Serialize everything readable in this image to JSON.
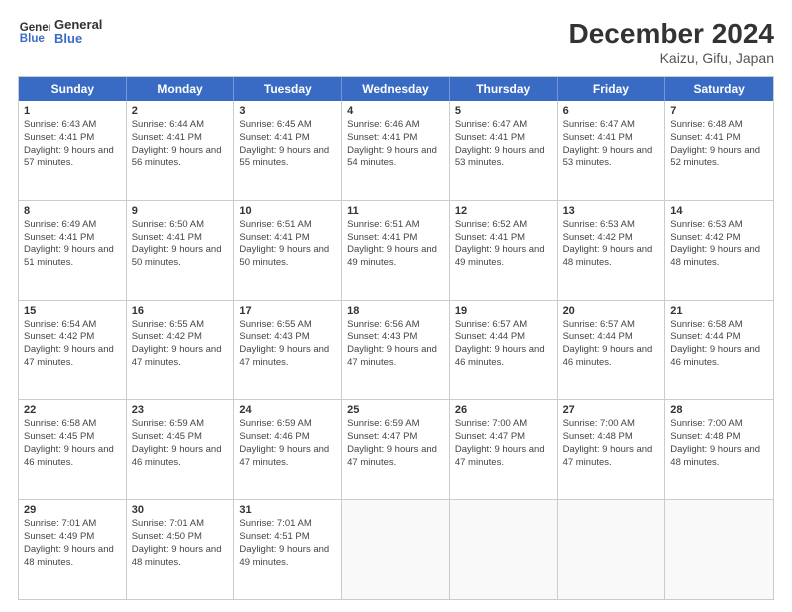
{
  "header": {
    "logo_line1": "General",
    "logo_line2": "Blue",
    "title": "December 2024",
    "subtitle": "Kaizu, Gifu, Japan"
  },
  "weekdays": [
    "Sunday",
    "Monday",
    "Tuesday",
    "Wednesday",
    "Thursday",
    "Friday",
    "Saturday"
  ],
  "weeks": [
    [
      {
        "day": "1",
        "rise": "6:43 AM",
        "set": "4:41 PM",
        "hours": "9 hours and 57 minutes."
      },
      {
        "day": "2",
        "rise": "6:44 AM",
        "set": "4:41 PM",
        "hours": "9 hours and 56 minutes."
      },
      {
        "day": "3",
        "rise": "6:45 AM",
        "set": "4:41 PM",
        "hours": "9 hours and 55 minutes."
      },
      {
        "day": "4",
        "rise": "6:46 AM",
        "set": "4:41 PM",
        "hours": "9 hours and 54 minutes."
      },
      {
        "day": "5",
        "rise": "6:47 AM",
        "set": "4:41 PM",
        "hours": "9 hours and 53 minutes."
      },
      {
        "day": "6",
        "rise": "6:47 AM",
        "set": "4:41 PM",
        "hours": "9 hours and 53 minutes."
      },
      {
        "day": "7",
        "rise": "6:48 AM",
        "set": "4:41 PM",
        "hours": "9 hours and 52 minutes."
      }
    ],
    [
      {
        "day": "8",
        "rise": "6:49 AM",
        "set": "4:41 PM",
        "hours": "9 hours and 51 minutes."
      },
      {
        "day": "9",
        "rise": "6:50 AM",
        "set": "4:41 PM",
        "hours": "9 hours and 50 minutes."
      },
      {
        "day": "10",
        "rise": "6:51 AM",
        "set": "4:41 PM",
        "hours": "9 hours and 50 minutes."
      },
      {
        "day": "11",
        "rise": "6:51 AM",
        "set": "4:41 PM",
        "hours": "9 hours and 49 minutes."
      },
      {
        "day": "12",
        "rise": "6:52 AM",
        "set": "4:41 PM",
        "hours": "9 hours and 49 minutes."
      },
      {
        "day": "13",
        "rise": "6:53 AM",
        "set": "4:42 PM",
        "hours": "9 hours and 48 minutes."
      },
      {
        "day": "14",
        "rise": "6:53 AM",
        "set": "4:42 PM",
        "hours": "9 hours and 48 minutes."
      }
    ],
    [
      {
        "day": "15",
        "rise": "6:54 AM",
        "set": "4:42 PM",
        "hours": "9 hours and 47 minutes."
      },
      {
        "day": "16",
        "rise": "6:55 AM",
        "set": "4:42 PM",
        "hours": "9 hours and 47 minutes."
      },
      {
        "day": "17",
        "rise": "6:55 AM",
        "set": "4:43 PM",
        "hours": "9 hours and 47 minutes."
      },
      {
        "day": "18",
        "rise": "6:56 AM",
        "set": "4:43 PM",
        "hours": "9 hours and 47 minutes."
      },
      {
        "day": "19",
        "rise": "6:57 AM",
        "set": "4:44 PM",
        "hours": "9 hours and 46 minutes."
      },
      {
        "day": "20",
        "rise": "6:57 AM",
        "set": "4:44 PM",
        "hours": "9 hours and 46 minutes."
      },
      {
        "day": "21",
        "rise": "6:58 AM",
        "set": "4:44 PM",
        "hours": "9 hours and 46 minutes."
      }
    ],
    [
      {
        "day": "22",
        "rise": "6:58 AM",
        "set": "4:45 PM",
        "hours": "9 hours and 46 minutes."
      },
      {
        "day": "23",
        "rise": "6:59 AM",
        "set": "4:45 PM",
        "hours": "9 hours and 46 minutes."
      },
      {
        "day": "24",
        "rise": "6:59 AM",
        "set": "4:46 PM",
        "hours": "9 hours and 47 minutes."
      },
      {
        "day": "25",
        "rise": "6:59 AM",
        "set": "4:47 PM",
        "hours": "9 hours and 47 minutes."
      },
      {
        "day": "26",
        "rise": "7:00 AM",
        "set": "4:47 PM",
        "hours": "9 hours and 47 minutes."
      },
      {
        "day": "27",
        "rise": "7:00 AM",
        "set": "4:48 PM",
        "hours": "9 hours and 47 minutes."
      },
      {
        "day": "28",
        "rise": "7:00 AM",
        "set": "4:48 PM",
        "hours": "9 hours and 48 minutes."
      }
    ],
    [
      {
        "day": "29",
        "rise": "7:01 AM",
        "set": "4:49 PM",
        "hours": "9 hours and 48 minutes."
      },
      {
        "day": "30",
        "rise": "7:01 AM",
        "set": "4:50 PM",
        "hours": "9 hours and 48 minutes."
      },
      {
        "day": "31",
        "rise": "7:01 AM",
        "set": "4:51 PM",
        "hours": "9 hours and 49 minutes."
      },
      null,
      null,
      null,
      null
    ]
  ]
}
